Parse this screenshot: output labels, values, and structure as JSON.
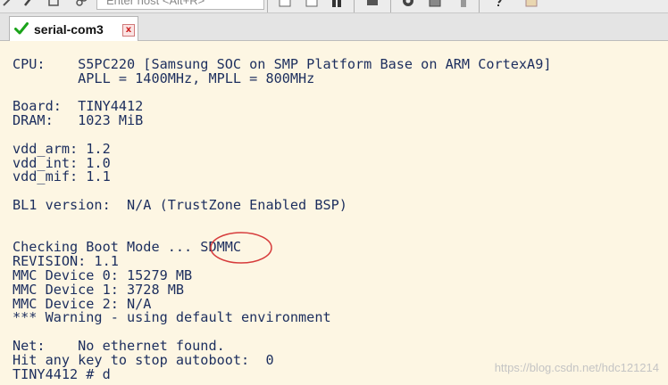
{
  "toolbar": {
    "host_placeholder": "Enter host <Alt+R>",
    "icons": [
      "link-icon",
      "pin-icon",
      "reconnect-icon",
      "chain-icon",
      "window-icon",
      "window-icon",
      "binoculars-icon",
      "print-icon",
      "gear-icon",
      "keypad-icon",
      "lock-icon",
      "help-icon",
      "map-icon"
    ]
  },
  "tab": {
    "label": "serial-com3",
    "close": "x",
    "status_color": "#1aa31a"
  },
  "terminal": {
    "lines": [
      "CPU:    S5PC220 [Samsung SOC on SMP Platform Base on ARM CortexA9]",
      "        APLL = 1400MHz, MPLL = 800MHz",
      "",
      "Board:  TINY4412",
      "DRAM:   1023 MiB",
      "",
      "vdd_arm: 1.2",
      "vdd_int: 1.0",
      "vdd_mif: 1.1",
      "",
      "BL1 version:  N/A (TrustZone Enabled BSP)",
      "",
      "",
      "Checking Boot Mode ... SDMMC",
      "REVISION: 1.1",
      "MMC Device 0: 15279 MB",
      "MMC Device 1: 3728 MB",
      "MMC Device 2: N/A",
      "*** Warning - using default environment",
      "",
      "Net:    No ethernet found.",
      "Hit any key to stop autoboot:  0",
      "TINY4412 # d"
    ],
    "text_color": "#1c2e5e",
    "background": "#fdf6e3",
    "annotation_color": "#d63b3b"
  },
  "watermark": "https://blog.csdn.net/hdc121214"
}
